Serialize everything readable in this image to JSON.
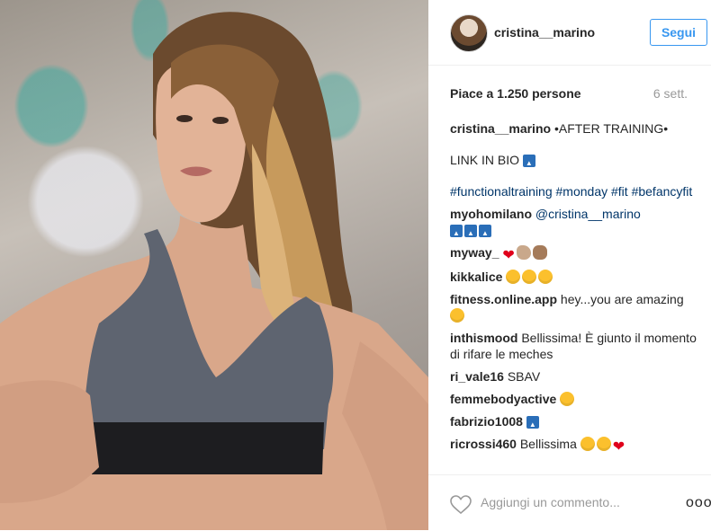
{
  "post": {
    "author": "cristina__marino",
    "follow_label": "Segui",
    "likes_text": "Piace a 1.250 persone",
    "time_text": "6 sett.",
    "caption": {
      "user": "cristina__marino",
      "text": "•AFTER TRAINING•",
      "line2": "LINK IN BIO",
      "hashtags": "#functionaltraining #monday #fit #befancyfit"
    },
    "comments": [
      {
        "user": "myohomilano",
        "text": "@cristina__marino",
        "emojis": [
          "top-emoji",
          "top-emoji",
          "top-emoji"
        ]
      },
      {
        "user": "myway_",
        "text": "",
        "emojis": [
          "red-heart-emoji",
          "flexed-biceps-emoji",
          "ok-hand-emoji"
        ]
      },
      {
        "user": "kikkalice",
        "text": "",
        "emojis": [
          "heart-eyes-emoji",
          "heart-eyes-emoji",
          "heart-eyes-emoji"
        ]
      },
      {
        "user": "fitness.online.app",
        "text": "hey...you are amazing",
        "emojis": [
          "grimacing-emoji"
        ]
      },
      {
        "user": "inthismood",
        "text": "Bellissima! È giunto il momento di rifare le meches",
        "emojis": []
      },
      {
        "user": "ri_vale16",
        "text": "SBAV",
        "emojis": []
      },
      {
        "user": "femmebodyactive",
        "text": "",
        "emojis": [
          "grinning-emoji"
        ]
      },
      {
        "user": "fabrizio1008",
        "text": "",
        "emojis": [
          "top-emoji"
        ]
      },
      {
        "user": "ricrossi460",
        "text": "Bellissima",
        "emojis": [
          "heart-eyes-emoji",
          "blush-emoji",
          "red-heart-emoji"
        ]
      }
    ],
    "comment_placeholder": "Aggiungi un commento...",
    "more_label": "ooo"
  },
  "colors": {
    "link_blue": "#3897f0",
    "hashtag": "#003569",
    "muted": "#999999"
  }
}
